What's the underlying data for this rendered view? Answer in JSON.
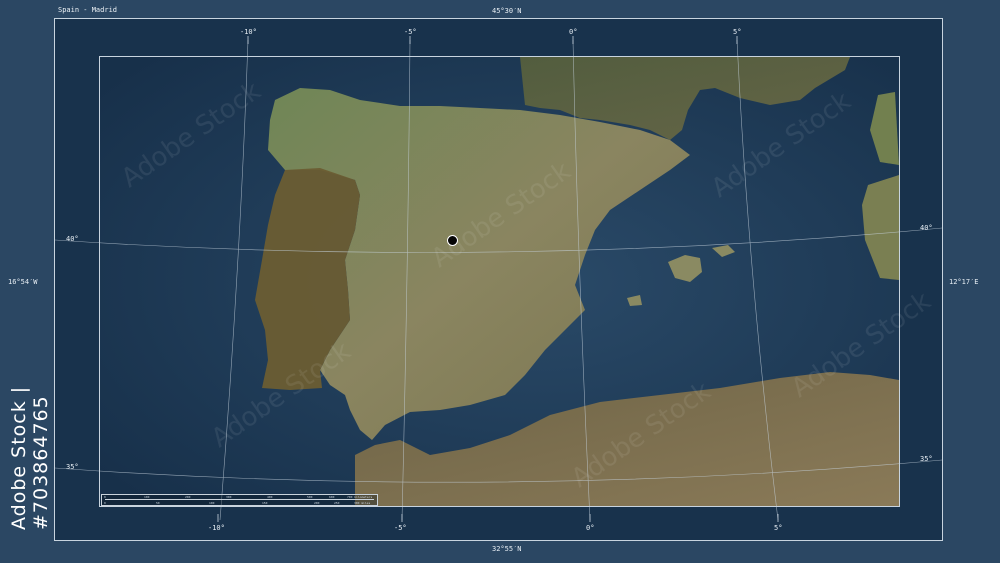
{
  "title": "Spain - Madrid",
  "stock_id": "Adobe Stock | #703864765",
  "watermark_text": "Adobe Stock",
  "frame_labels": {
    "top": "45°30′N",
    "bottom": "32°55′N",
    "left": "16°54′W",
    "right": "12°17′E"
  },
  "graticule_labels": {
    "top": [
      "-10°",
      "-5°",
      "0°",
      "5°"
    ],
    "bottom": [
      "-10°",
      "-5°",
      "0°",
      "5°"
    ],
    "left": [
      "40°",
      "35°"
    ],
    "right": [
      "40°",
      "35°"
    ]
  },
  "scalebar": {
    "top_ticks": [
      "0",
      "100",
      "200",
      "300",
      "400",
      "500",
      "600",
      "700 kilometers"
    ],
    "bottom_ticks": [
      "0",
      "50",
      "100",
      "150",
      "200",
      "250",
      "300 miles"
    ]
  },
  "colors": {
    "sea": "#24405c",
    "land": "#6d7352",
    "highlight_country": "#7a8a55",
    "neighbor_dim": "#5b4a2e",
    "marker": "#050505"
  }
}
